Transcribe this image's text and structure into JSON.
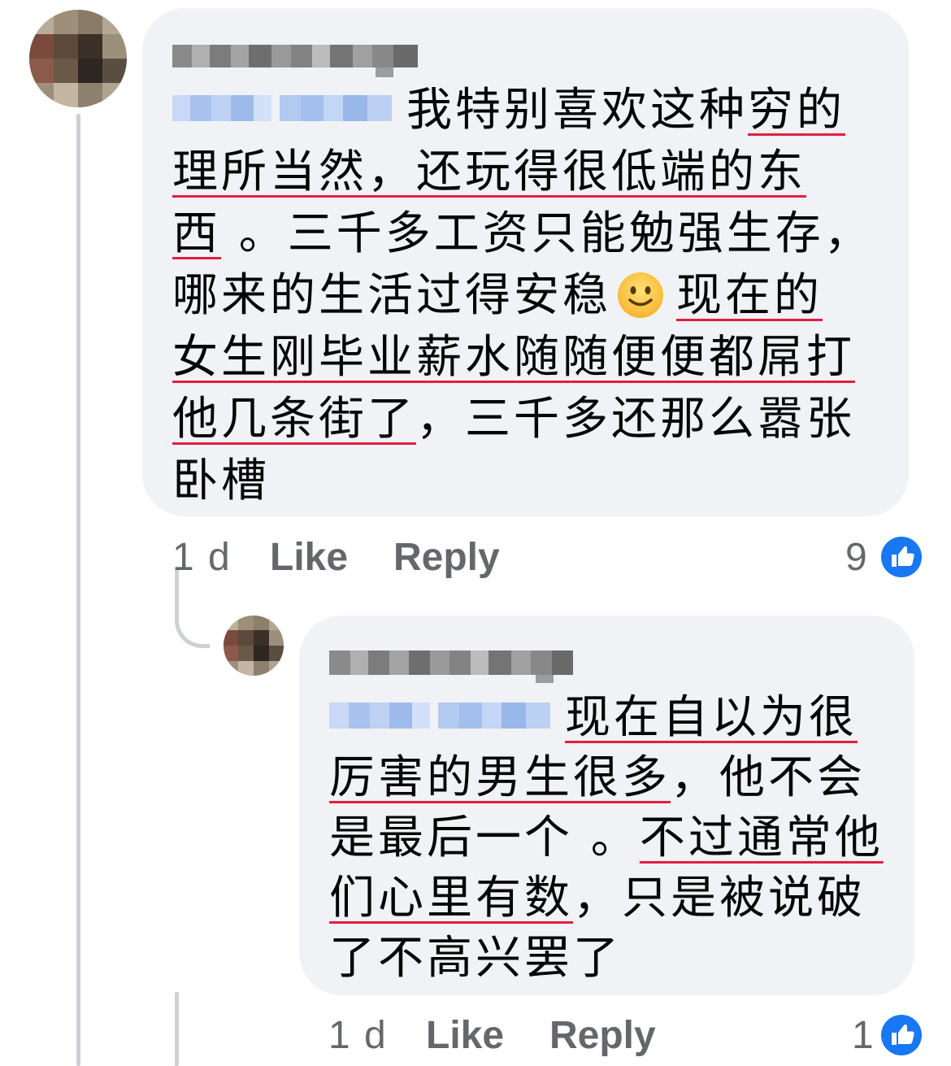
{
  "colors": {
    "bubble": "#f0f2f5",
    "text": "#050505",
    "secondary_text": "#65676b",
    "like_blue": "#1877f2",
    "spell_underline": "#e41e3f",
    "thread_line": "#ced0d4"
  },
  "comment": {
    "avatar_icon": "blurred-profile-avatar",
    "author_name": "",
    "mention_name": "",
    "lines": [
      {
        "segments": [
          {
            "text": "我特别喜欢这种"
          },
          {
            "text": "穷的",
            "underline": true
          }
        ]
      },
      {
        "segments": [
          {
            "text": "理所当然，还玩得很低端的东",
            "underline": true
          }
        ]
      },
      {
        "segments": [
          {
            "text": "西",
            "underline": true
          },
          {
            "text": " 。三千多工资只能勉强生存，"
          }
        ]
      },
      {
        "segments": [
          {
            "text": "哪来的生活过得安稳"
          },
          {
            "text": "现在的",
            "underline": true
          }
        ]
      },
      {
        "segments": [
          {
            "text": "女生刚毕业薪水随随便便都屌打",
            "underline": true
          }
        ]
      },
      {
        "segments": [
          {
            "text": "他几条街了",
            "underline": true
          },
          {
            "text": "，三千多还那么嚣张"
          }
        ]
      },
      {
        "segments": [
          {
            "text": "卧槽"
          }
        ]
      }
    ],
    "emoji": "slightly-smiling-face",
    "time": "1 d",
    "like_label": "Like",
    "reply_label": "Reply",
    "reaction_count": "9",
    "reaction_icon": "like-icon"
  },
  "reply": {
    "avatar_icon": "blurred-profile-avatar",
    "author_name": "",
    "mention_name": "",
    "lines": [
      {
        "segments": [
          {
            "text": "现在自以为很",
            "underline": true
          }
        ]
      },
      {
        "segments": [
          {
            "text": "厉害的男生很多",
            "underline": true
          },
          {
            "text": "，他不会"
          }
        ]
      },
      {
        "segments": [
          {
            "text": "是最后一个 。"
          },
          {
            "text": "不过通常他",
            "underline": true
          }
        ]
      },
      {
        "segments": [
          {
            "text": "们心里有数",
            "underline": true
          },
          {
            "text": "，只是被说破"
          }
        ]
      },
      {
        "segments": [
          {
            "text": "了不高兴罢了"
          }
        ]
      }
    ],
    "time": "1 d",
    "like_label": "Like",
    "reply_label": "Reply",
    "reaction_count": "1",
    "reaction_icon": "like-icon"
  }
}
